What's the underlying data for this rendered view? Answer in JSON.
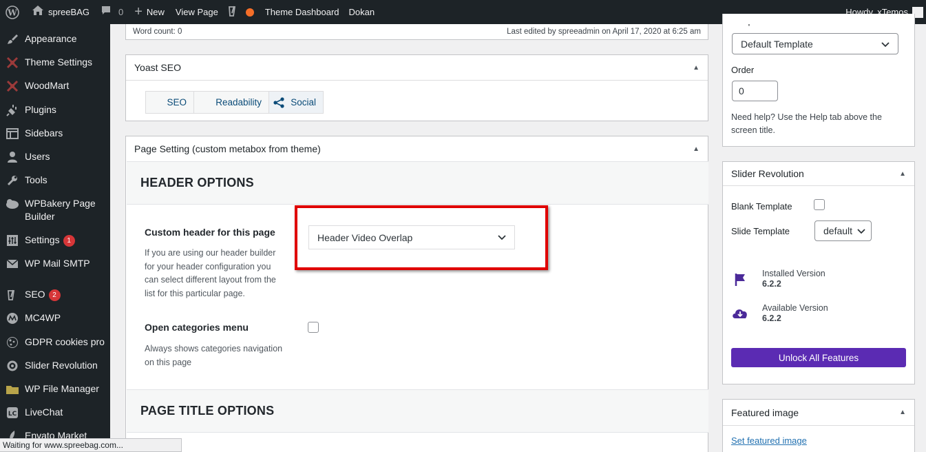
{
  "adminbar": {
    "site_name": "spreeBAG",
    "comments_count": "0",
    "new_label": "New",
    "view_page": "View Page",
    "theme_dashboard": "Theme Dashboard",
    "dokan": "Dokan",
    "howdy": "Howdy, xTemos"
  },
  "sidebar": {
    "items": [
      {
        "label": "Appearance",
        "icon": "paintbrush-icon"
      },
      {
        "label": "Theme Settings",
        "icon": "theme-settings-icon"
      },
      {
        "label": "WoodMart",
        "icon": "woodmart-icon"
      },
      {
        "label": "Plugins",
        "icon": "plugin-icon"
      },
      {
        "label": "Sidebars",
        "icon": "sidebars-icon"
      },
      {
        "label": "Users",
        "icon": "users-icon"
      },
      {
        "label": "Tools",
        "icon": "wrench-icon"
      },
      {
        "label": "WPBakery Page",
        "label2": "Builder",
        "icon": "wpbakery-icon"
      },
      {
        "label": "Settings",
        "icon": "settings-icon",
        "badge": "1"
      },
      {
        "label": "WP Mail SMTP",
        "icon": "mail-icon"
      },
      {
        "label": "SEO",
        "icon": "yoast-icon",
        "badge": "2"
      },
      {
        "label": "MC4WP",
        "icon": "mc4wp-icon"
      },
      {
        "label": "GDPR cookies pro",
        "icon": "cookie-icon"
      },
      {
        "label": "Slider Revolution",
        "icon": "slider-revolution-icon"
      },
      {
        "label": "WP File Manager",
        "icon": "folder-icon"
      },
      {
        "label": "LiveChat",
        "icon": "livechat-icon"
      },
      {
        "label": "Envato Market",
        "icon": "envato-icon"
      }
    ]
  },
  "editor_footer": {
    "word_count": "Word count: 0",
    "last_edited": "Last edited by spreeadmin on April 17, 2020 at 6:25 am"
  },
  "yoast": {
    "title": "Yoast SEO",
    "tabs": [
      "SEO",
      "Readability",
      "Social"
    ]
  },
  "page_setting": {
    "title": "Page Setting (custom metabox from theme)",
    "header_options": "HEADER OPTIONS",
    "custom_header_title": "Custom header for this page",
    "custom_header_desc": [
      "If you are using our header builder",
      "for your header configuration you",
      "can select different layout from the",
      "list for this particular page."
    ],
    "custom_header_value": "Header Video Overlap",
    "open_categories_title": "Open categories menu",
    "open_categories_desc": [
      "Always shows categories navigation",
      "on this page"
    ],
    "page_title_options": "PAGE TITLE OPTIONS"
  },
  "page_attributes": {
    "template_label": "Template",
    "template_value": "Default Template",
    "order_label": "Order",
    "order_value": "0",
    "help": [
      "Need help? Use the Help tab above the",
      "screen title."
    ]
  },
  "slider_revolution": {
    "title": "Slider Revolution",
    "blank_template": "Blank Template",
    "slide_template": "Slide Template",
    "slide_template_value": "default",
    "installed_label": "Installed Version",
    "installed_value": "6.2.2",
    "available_label": "Available Version",
    "available_value": "6.2.2",
    "unlock_button": "Unlock All Features",
    "accent_color": "#5b2bb3"
  },
  "featured_image": {
    "title": "Featured image",
    "link": "Set featured image"
  },
  "status": {
    "text": "Waiting for www.spreebag.com..."
  }
}
